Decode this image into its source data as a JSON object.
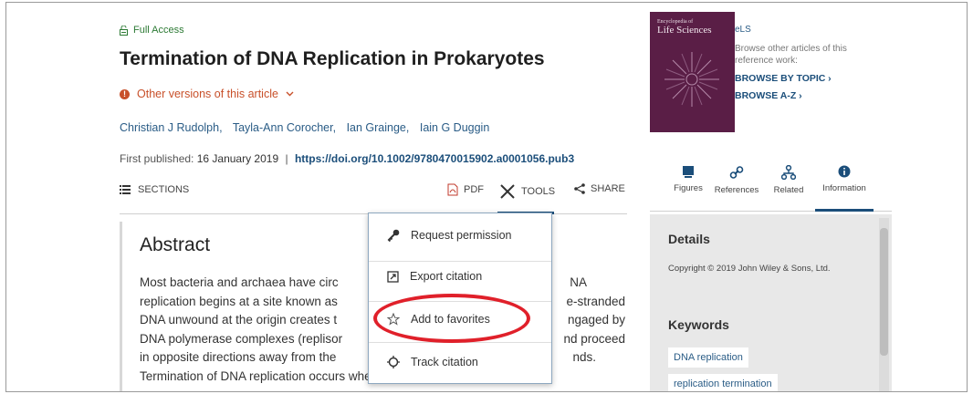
{
  "article": {
    "access_label": "Full Access",
    "title": "Termination of DNA Replication in Prokaryotes",
    "other_versions": "Other versions of this article",
    "authors": [
      "Christian J Rudolph,",
      "Tayla-Ann Corocher,",
      "Ian Grainge,",
      "Iain G Duggin"
    ],
    "first_published_label": "First published:",
    "first_published_date": "16 January 2019",
    "separator": "|",
    "doi": "https://doi.org/10.1002/9780470015902.a0001056.pub3"
  },
  "toolbar": {
    "sections": "SECTIONS",
    "pdf": "PDF",
    "tools": "TOOLS",
    "share": "SHARE"
  },
  "tools_menu": {
    "items": [
      "Request permission",
      "Export citation",
      "Add to favorites",
      "Track citation"
    ]
  },
  "abstract": {
    "heading": "Abstract",
    "lines": [
      "Most bacteria and archaea have circ",
      "replication begins at a site known as",
      "DNA unwound at the origin creates t",
      "DNA polymerase complexes (replisor",
      "in opposite directions away from the",
      "Termination of DNA replication occurs when the two forks meet and fuse,"
    ],
    "lines_right": [
      "NA",
      "e-stranded",
      "ngaged by",
      "nd proceed",
      "nds.",
      ""
    ]
  },
  "sidebar": {
    "cover_small": "Encyclopedia of",
    "cover_title": "Life Sciences",
    "series": "eLS",
    "browse_desc": "Browse other articles of this reference work:",
    "browse_topic": "BROWSE BY TOPIC",
    "browse_az": "BROWSE A-Z",
    "tabs": [
      "Figures",
      "References",
      "Related",
      "Information"
    ],
    "details_heading": "Details",
    "copyright": "Copyright © 2019 John Wiley & Sons, Ltd.",
    "keywords_heading": "Keywords",
    "keywords": [
      "DNA replication",
      "replication termination"
    ]
  },
  "colors": {
    "accent": "#1b4e7a",
    "warning": "#c8502a",
    "highlight": "#e0202a",
    "cover": "#5a1e46"
  },
  "icons": [
    "lock-open-icon",
    "info-icon",
    "sections-list-icon",
    "pdf-icon",
    "tools-icon",
    "share-icon",
    "key-icon",
    "export-icon",
    "star-icon",
    "track-icon",
    "figures-icon",
    "references-link-icon",
    "related-icon",
    "information-icon"
  ]
}
